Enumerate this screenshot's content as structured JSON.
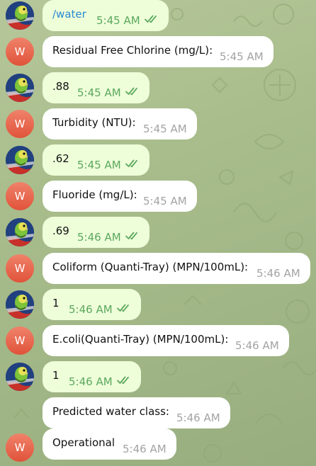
{
  "messages": [
    {
      "side": "out",
      "text": "/water",
      "time": "5:45 AM",
      "link": true
    },
    {
      "side": "in",
      "text": "Residual Free Chlorine (mg/L):",
      "time": "5:45 AM"
    },
    {
      "side": "out",
      "text": ".88",
      "time": "5:45 AM"
    },
    {
      "side": "in",
      "text": "Turbidity (NTU):",
      "time": "5:45 AM"
    },
    {
      "side": "out",
      "text": ".62",
      "time": "5:45 AM"
    },
    {
      "side": "in",
      "text": "Fluoride (mg/L):",
      "time": "5:45 AM"
    },
    {
      "side": "out",
      "text": ".69",
      "time": "5:46 AM"
    },
    {
      "side": "in",
      "text": "Coliform (Quanti-Tray) (MPN/100mL):",
      "time": "5:46 AM"
    },
    {
      "side": "out",
      "text": "1",
      "time": "5:46 AM"
    },
    {
      "side": "in",
      "text": "E.coli(Quanti-Tray) (MPN/100mL):",
      "time": "5:46 AM"
    },
    {
      "side": "out",
      "text": "1",
      "time": "5:46 AM"
    },
    {
      "side": "in",
      "text": "Predicted water class:",
      "time": "5:46 AM"
    },
    {
      "side": "in",
      "text": "Operational",
      "time": "5:46 AM"
    }
  ],
  "bot_avatar_letter": "W",
  "colors": {
    "outgoing_bubble": "#eefed9",
    "incoming_bubble": "#ffffff",
    "read_check": "#5ba85e",
    "bot_avatar": "#e0533a",
    "link": "#2a8ad4"
  }
}
